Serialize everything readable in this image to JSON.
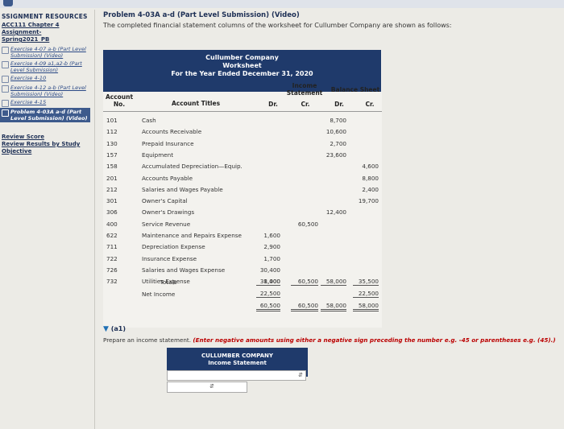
{
  "sidebar": {
    "heading": "SSIGNMENT RESOURCES",
    "course": [
      "ACC111 Chapter 4",
      "Assignment-",
      "Spring2021_PB"
    ],
    "items": [
      {
        "label": "Exercise 4-07 a-b (Part Level Submission) (Video)",
        "active": false
      },
      {
        "label": "Exercise 4-09 a1,a2-b (Part Level Submission)",
        "active": false
      },
      {
        "label": "Exercise 4-10",
        "active": false
      },
      {
        "label": "Exercise 4-12 a-b (Part Level Submission) (Video)",
        "active": false
      },
      {
        "label": "Exercise 4-15",
        "active": false
      },
      {
        "label": "Problem 4-03A a-d (Part Level Submission) (Video)",
        "active": true
      }
    ],
    "links": [
      "Review Score",
      "Review Results by Study Objective"
    ]
  },
  "problem": {
    "title": "Problem 4-03A a-d (Part Level Submission) (Video)",
    "description": "The completed financial statement columns of the worksheet for Cullumber Company are shown as follows:"
  },
  "worksheet": {
    "company": "Cullumber Company",
    "name": "Worksheet",
    "period": "For the Year Ended December 31, 2020",
    "col_account_no": [
      "Account",
      "No."
    ],
    "col_titles": "Account Titles",
    "col_income": [
      "Income",
      "Statement"
    ],
    "col_balance": "Balance Sheet",
    "dr": "Dr.",
    "cr": "Cr.",
    "rows": [
      {
        "no": "101",
        "title": "Cash",
        "is_dr": "",
        "is_cr": "",
        "bs_dr": "8,700",
        "bs_cr": ""
      },
      {
        "no": "112",
        "title": "Accounts Receivable",
        "is_dr": "",
        "is_cr": "",
        "bs_dr": "10,600",
        "bs_cr": ""
      },
      {
        "no": "130",
        "title": "Prepaid Insurance",
        "is_dr": "",
        "is_cr": "",
        "bs_dr": "2,700",
        "bs_cr": ""
      },
      {
        "no": "157",
        "title": "Equipment",
        "is_dr": "",
        "is_cr": "",
        "bs_dr": "23,600",
        "bs_cr": ""
      },
      {
        "no": "158",
        "title": "Accumulated Depreciation—Equip.",
        "is_dr": "",
        "is_cr": "",
        "bs_dr": "",
        "bs_cr": "4,600"
      },
      {
        "no": "201",
        "title": "Accounts Payable",
        "is_dr": "",
        "is_cr": "",
        "bs_dr": "",
        "bs_cr": "8,800"
      },
      {
        "no": "212",
        "title": "Salaries and Wages Payable",
        "is_dr": "",
        "is_cr": "",
        "bs_dr": "",
        "bs_cr": "2,400"
      },
      {
        "no": "301",
        "title": "Owner's Capital",
        "is_dr": "",
        "is_cr": "",
        "bs_dr": "",
        "bs_cr": "19,700"
      },
      {
        "no": "306",
        "title": "Owner's Drawings",
        "is_dr": "",
        "is_cr": "",
        "bs_dr": "12,400",
        "bs_cr": ""
      },
      {
        "no": "400",
        "title": "Service Revenue",
        "is_dr": "",
        "is_cr": "60,500",
        "bs_dr": "",
        "bs_cr": ""
      },
      {
        "no": "622",
        "title": "Maintenance and Repairs Expense",
        "is_dr": "1,600",
        "is_cr": "",
        "bs_dr": "",
        "bs_cr": ""
      },
      {
        "no": "711",
        "title": "Depreciation Expense",
        "is_dr": "2,900",
        "is_cr": "",
        "bs_dr": "",
        "bs_cr": ""
      },
      {
        "no": "722",
        "title": "Insurance Expense",
        "is_dr": "1,700",
        "is_cr": "",
        "bs_dr": "",
        "bs_cr": ""
      },
      {
        "no": "726",
        "title": "Salaries and Wages Expense",
        "is_dr": "30,400",
        "is_cr": "",
        "bs_dr": "",
        "bs_cr": ""
      },
      {
        "no": "732",
        "title": "Utilities Expense",
        "is_dr": "1,400",
        "is_cr": "",
        "bs_dr": "",
        "bs_cr": ""
      }
    ],
    "totals": {
      "title": "Totals",
      "is_dr": "38,000",
      "is_cr": "60,500",
      "bs_dr": "58,000",
      "bs_cr": "35,500"
    },
    "net_income": {
      "title": "Net Income",
      "is_dr": "22,500",
      "bs_cr": "22,500"
    },
    "final": {
      "is_dr": "60,500",
      "is_cr": "60,500",
      "bs_dr": "58,000",
      "bs_cr": "58,000"
    }
  },
  "part": {
    "label": "(a1)",
    "instruction_plain": "Prepare an income statement.",
    "instruction_note": "(Enter negative amounts using either a negative sign preceding the number e.g. -45 or parentheses e.g. (45).)"
  },
  "statement": {
    "company": "CULLUMBER COMPANY",
    "title": "Income Statement",
    "select1_value": "",
    "select2_value": ""
  }
}
